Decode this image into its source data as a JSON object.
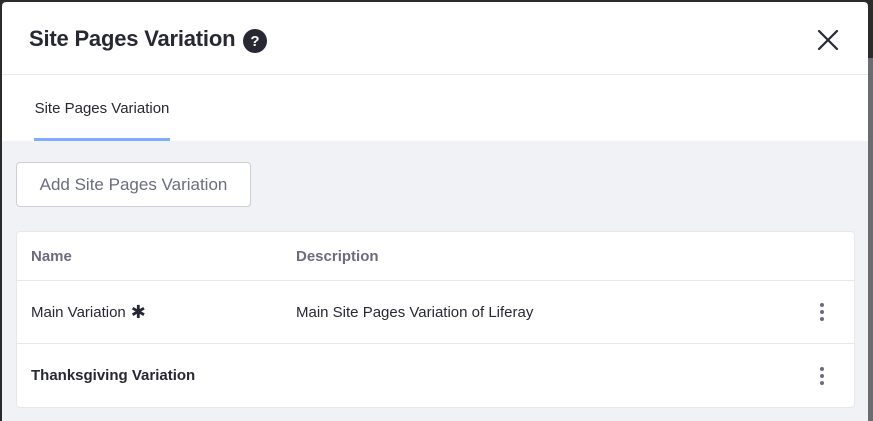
{
  "modal": {
    "title": "Site Pages Variation",
    "help_icon": "?",
    "close_icon": "close-icon"
  },
  "tabs": [
    {
      "label": "Site Pages Variation",
      "active": true
    }
  ],
  "toolbar": {
    "add_label": "Add Site Pages Variation"
  },
  "table": {
    "columns": [
      "Name",
      "Description"
    ],
    "rows": [
      {
        "name": "Main Variation",
        "required_marker": "✱",
        "description": "Main Site Pages Variation of Liferay"
      },
      {
        "name": "Thanksgiving Variation",
        "description": ""
      }
    ]
  },
  "colors": {
    "title": "#272833",
    "secondary": "#6b6c7e",
    "tab_underline": "#80acff",
    "content_bg": "#f1f2f5"
  }
}
